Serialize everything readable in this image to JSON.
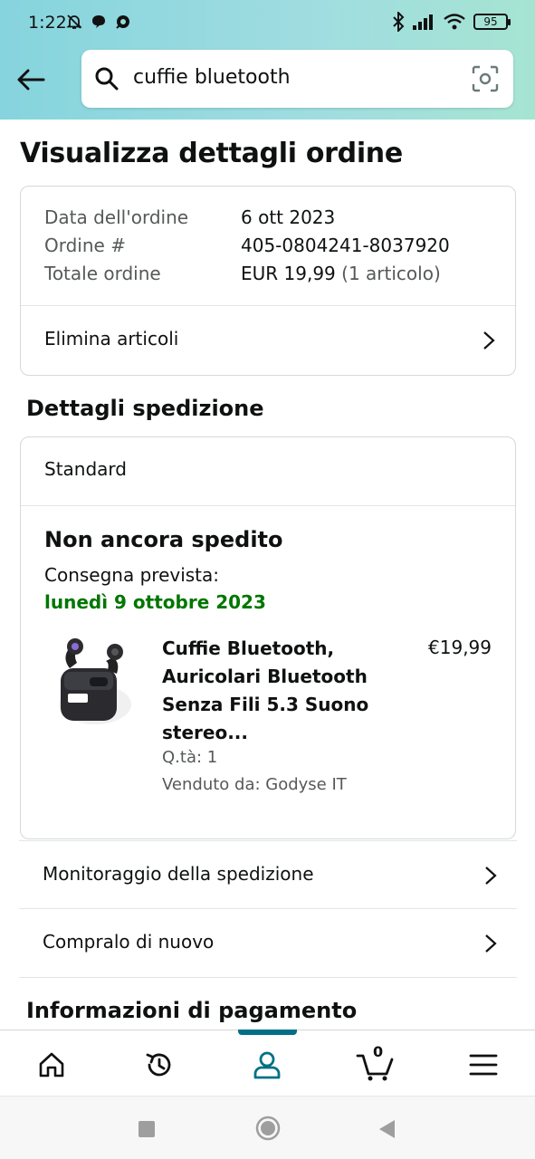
{
  "status_bar": {
    "time": "1:22",
    "battery": "95"
  },
  "search": {
    "query": "cuffie bluetooth"
  },
  "page": {
    "title": "Visualizza dettagli ordine"
  },
  "order_summary": {
    "rows": [
      {
        "label": "Data dell'ordine",
        "value": "6 ott 2023",
        "extra": ""
      },
      {
        "label": "Ordine #",
        "value": "405-0804241-8037920",
        "extra": ""
      },
      {
        "label": "Totale ordine",
        "value": "EUR 19,99",
        "extra": " (1 articolo)"
      }
    ],
    "delete_items_label": "Elimina articoli"
  },
  "shipping": {
    "section_title": "Dettagli spedizione",
    "method": "Standard",
    "status": "Non ancora spedito",
    "delivery_label": "Consegna prevista:",
    "delivery_date": "lunedì 9 ottobre 2023",
    "delivery_date_color": "#007600",
    "product": {
      "title": "Cuffie Bluetooth, Auricolari Bluetooth Senza Fili 5.3 Suono stereo...",
      "price": "€19,99",
      "quantity": "Q.tà: 1",
      "seller": "Venduto da: Godyse IT"
    }
  },
  "actions": {
    "track_label": "Monitoraggio della spedizione",
    "buy_again_label": "Compralo di nuovo"
  },
  "payment": {
    "section_title": "Informazioni di pagamento"
  },
  "bottom_nav": {
    "active_color": "#007185",
    "items": [
      "home-icon",
      "history-icon",
      "account-icon",
      "cart-icon",
      "menu-icon"
    ],
    "cart_count": "0"
  }
}
